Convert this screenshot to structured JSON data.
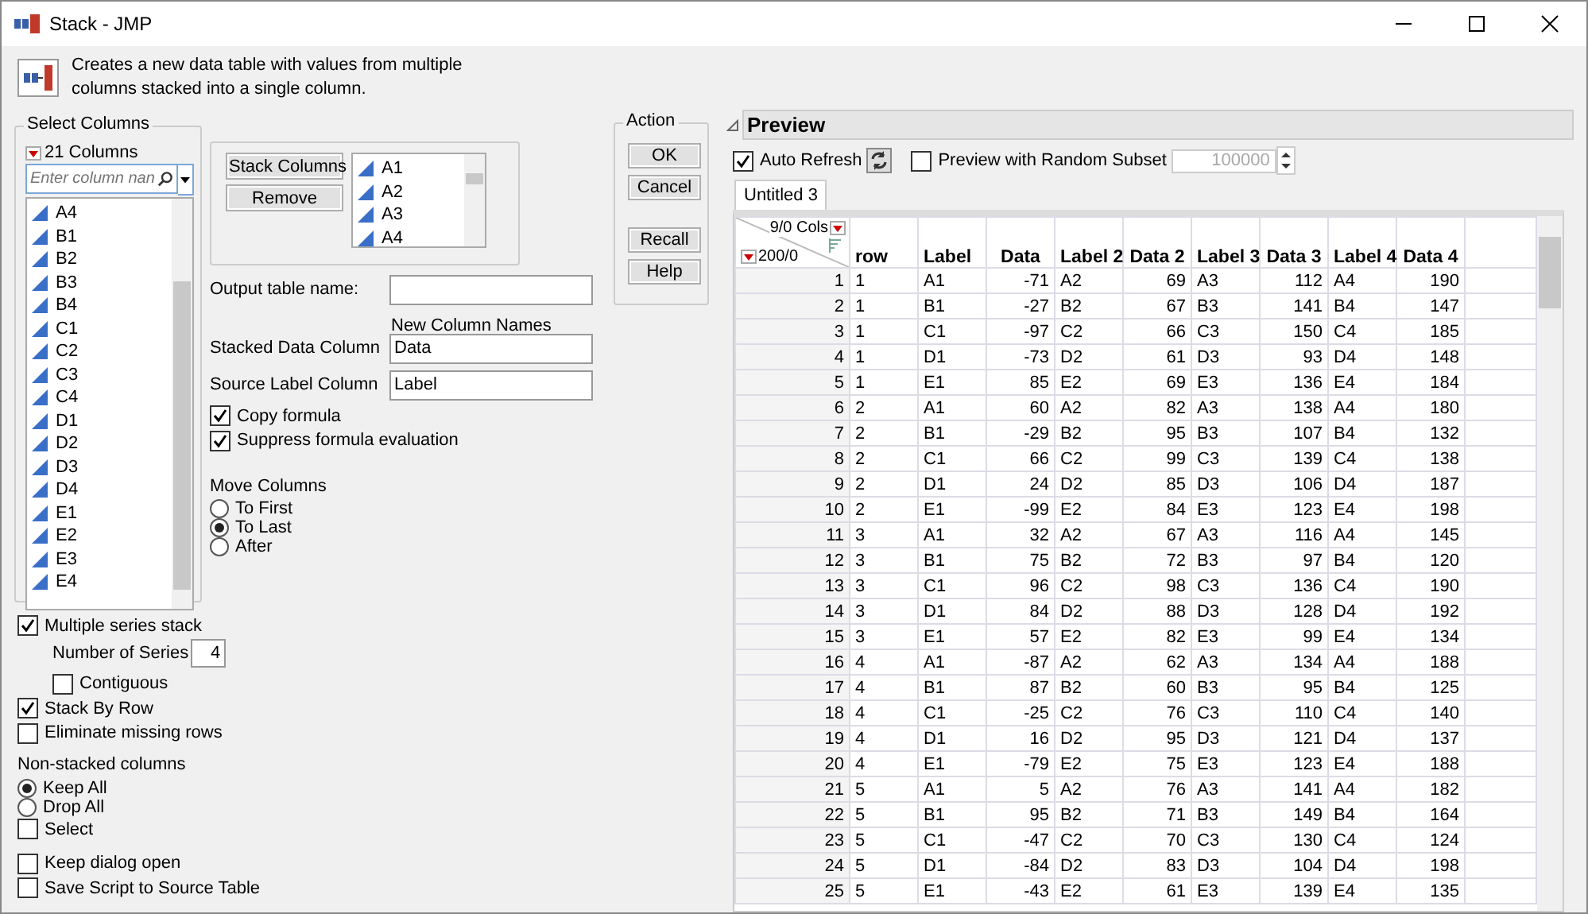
{
  "window": {
    "title": "Stack - JMP"
  },
  "description": "Creates a new data table with values from multiple columns stacked into a single column.",
  "select_columns": {
    "title": "Select Columns",
    "count": "21 Columns",
    "search_placeholder": "Enter column nan",
    "items": [
      "A4",
      "B1",
      "B2",
      "B3",
      "B4",
      "C1",
      "C2",
      "C3",
      "C4",
      "D1",
      "D2",
      "D3",
      "D4",
      "E1",
      "E2",
      "E3",
      "E4"
    ]
  },
  "stack_buttons": [
    "Stack Columns",
    "Remove"
  ],
  "stacked_list": [
    "A1",
    "A2",
    "A3",
    "A4"
  ],
  "output_table": {
    "label": "Output table name:"
  },
  "new_column_names": {
    "title": "New Column Names",
    "fields": [
      {
        "label": "Stacked Data Column",
        "value": "Data"
      },
      {
        "label": "Source Label Column",
        "value": "Label"
      }
    ]
  },
  "formula_options": [
    {
      "label": "Copy formula",
      "checked": true
    },
    {
      "label": "Suppress formula evaluation",
      "checked": true
    }
  ],
  "move_columns": {
    "title": "Move Columns",
    "options": [
      {
        "label": "To First",
        "selected": false
      },
      {
        "label": "To Last",
        "selected": true
      },
      {
        "label": "After",
        "selected": false
      }
    ]
  },
  "action": {
    "title": "Action",
    "buttons": [
      [
        "OK",
        "Cancel"
      ],
      [
        "Recall",
        "Help"
      ]
    ]
  },
  "option_groups": [
    [
      {
        "kind": "checkbox",
        "label": "Multiple series stack",
        "checked": true,
        "children": [
          {
            "kind": "number",
            "label": "Number of Series",
            "value": "4"
          },
          {
            "kind": "checkbox",
            "label": "Contiguous",
            "checked": false
          }
        ]
      },
      {
        "kind": "checkbox",
        "label": "Stack By Row",
        "checked": true
      },
      {
        "kind": "checkbox",
        "label": "Eliminate missing rows",
        "checked": false
      }
    ],
    [
      {
        "kind": "heading",
        "label": "Non-stacked columns"
      },
      {
        "kind": "radio",
        "label": "Keep All",
        "selected": true
      },
      {
        "kind": "radio",
        "label": "Drop All",
        "selected": false
      },
      {
        "kind": "checkbox",
        "label": "Select",
        "checked": false
      }
    ],
    [
      {
        "kind": "checkbox",
        "label": "Keep dialog open",
        "checked": false
      },
      {
        "kind": "checkbox",
        "label": "Save Script to Source Table",
        "checked": false
      }
    ]
  ],
  "preview": {
    "title": "Preview",
    "auto_refresh": {
      "label": "Auto Refresh",
      "checked": true
    },
    "random_subset": {
      "label": "Preview with Random Subset",
      "checked": false,
      "value": "100000"
    },
    "tabs": [
      {
        "label": "Untitled 3",
        "selected": true
      }
    ],
    "table": {
      "cols_summary": "9/0 Cols",
      "rows_summary": "200/0",
      "columns": [
        {
          "label": "row",
          "kind": "text"
        },
        {
          "label": "Label",
          "kind": "text"
        },
        {
          "label": "Data",
          "kind": "number"
        },
        {
          "label": "Label 2",
          "kind": "text"
        },
        {
          "label": "Data 2",
          "kind": "number"
        },
        {
          "label": "Label 3",
          "kind": "text"
        },
        {
          "label": "Data 3",
          "kind": "number"
        },
        {
          "label": "Label 4",
          "kind": "text"
        },
        {
          "label": "Data 4",
          "kind": "number"
        }
      ],
      "rows": [
        {
          "number": "1",
          "cells": [
            "1",
            "A1",
            "-71",
            "A2",
            "69",
            "A3",
            "112",
            "A4",
            "190"
          ]
        },
        {
          "number": "2",
          "cells": [
            "1",
            "B1",
            "-27",
            "B2",
            "67",
            "B3",
            "141",
            "B4",
            "147"
          ]
        },
        {
          "number": "3",
          "cells": [
            "1",
            "C1",
            "-97",
            "C2",
            "66",
            "C3",
            "150",
            "C4",
            "185"
          ]
        },
        {
          "number": "4",
          "cells": [
            "1",
            "D1",
            "-73",
            "D2",
            "61",
            "D3",
            "93",
            "D4",
            "148"
          ]
        },
        {
          "number": "5",
          "cells": [
            "1",
            "E1",
            "85",
            "E2",
            "69",
            "E3",
            "136",
            "E4",
            "184"
          ]
        },
        {
          "number": "6",
          "cells": [
            "2",
            "A1",
            "60",
            "A2",
            "82",
            "A3",
            "138",
            "A4",
            "180"
          ]
        },
        {
          "number": "7",
          "cells": [
            "2",
            "B1",
            "-29",
            "B2",
            "95",
            "B3",
            "107",
            "B4",
            "132"
          ]
        },
        {
          "number": "8",
          "cells": [
            "2",
            "C1",
            "66",
            "C2",
            "99",
            "C3",
            "139",
            "C4",
            "138"
          ]
        },
        {
          "number": "9",
          "cells": [
            "2",
            "D1",
            "24",
            "D2",
            "85",
            "D3",
            "106",
            "D4",
            "187"
          ]
        },
        {
          "number": "10",
          "cells": [
            "2",
            "E1",
            "-99",
            "E2",
            "84",
            "E3",
            "123",
            "E4",
            "198"
          ]
        },
        {
          "number": "11",
          "cells": [
            "3",
            "A1",
            "32",
            "A2",
            "67",
            "A3",
            "116",
            "A4",
            "145"
          ]
        },
        {
          "number": "12",
          "cells": [
            "3",
            "B1",
            "75",
            "B2",
            "72",
            "B3",
            "97",
            "B4",
            "120"
          ]
        },
        {
          "number": "13",
          "cells": [
            "3",
            "C1",
            "96",
            "C2",
            "98",
            "C3",
            "136",
            "C4",
            "190"
          ]
        },
        {
          "number": "14",
          "cells": [
            "3",
            "D1",
            "84",
            "D2",
            "88",
            "D3",
            "128",
            "D4",
            "192"
          ]
        },
        {
          "number": "15",
          "cells": [
            "3",
            "E1",
            "57",
            "E2",
            "82",
            "E3",
            "99",
            "E4",
            "134"
          ]
        },
        {
          "number": "16",
          "cells": [
            "4",
            "A1",
            "-87",
            "A2",
            "62",
            "A3",
            "134",
            "A4",
            "188"
          ]
        },
        {
          "number": "17",
          "cells": [
            "4",
            "B1",
            "87",
            "B2",
            "60",
            "B3",
            "95",
            "B4",
            "125"
          ]
        },
        {
          "number": "18",
          "cells": [
            "4",
            "C1",
            "-25",
            "C2",
            "76",
            "C3",
            "110",
            "C4",
            "140"
          ]
        },
        {
          "number": "19",
          "cells": [
            "4",
            "D1",
            "16",
            "D2",
            "95",
            "D3",
            "121",
            "D4",
            "137"
          ]
        },
        {
          "number": "20",
          "cells": [
            "4",
            "E1",
            "-79",
            "E2",
            "75",
            "E3",
            "123",
            "E4",
            "188"
          ]
        },
        {
          "number": "21",
          "cells": [
            "5",
            "A1",
            "5",
            "A2",
            "76",
            "A3",
            "141",
            "A4",
            "182"
          ]
        },
        {
          "number": "22",
          "cells": [
            "5",
            "B1",
            "95",
            "B2",
            "71",
            "B3",
            "149",
            "B4",
            "164"
          ]
        },
        {
          "number": "23",
          "cells": [
            "5",
            "C1",
            "-47",
            "C2",
            "70",
            "C3",
            "130",
            "C4",
            "124"
          ]
        },
        {
          "number": "24",
          "cells": [
            "5",
            "D1",
            "-84",
            "D2",
            "83",
            "D3",
            "104",
            "D4",
            "198"
          ]
        },
        {
          "number": "25",
          "cells": [
            "5",
            "E1",
            "-43",
            "E2",
            "61",
            "E3",
            "139",
            "E4",
            "135"
          ]
        }
      ]
    }
  }
}
